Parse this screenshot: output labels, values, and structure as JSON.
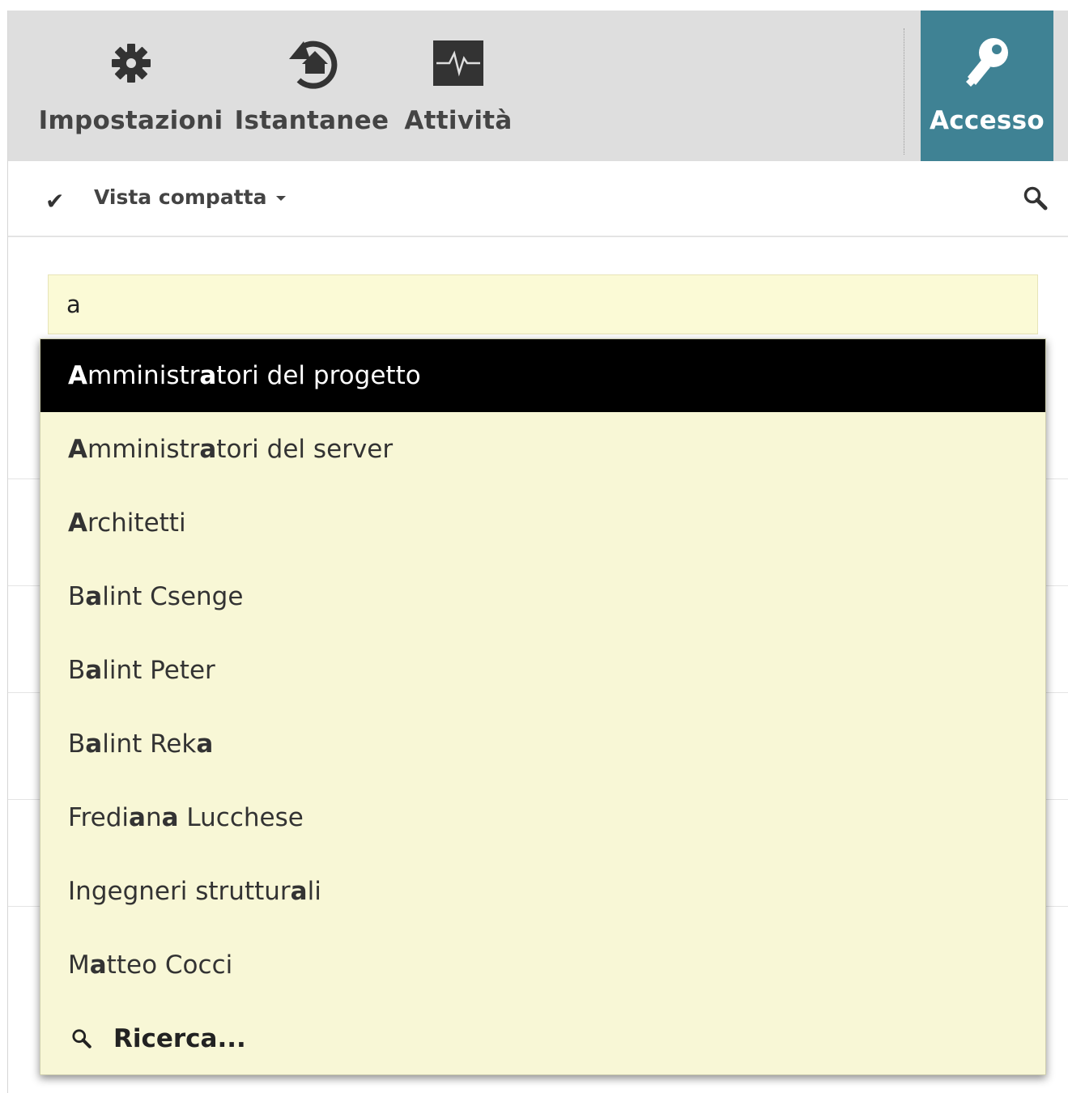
{
  "toolbar": {
    "impostazioni": {
      "label": "Impostazioni",
      "icon": "gear-icon"
    },
    "istantanee": {
      "label": "Istantanee",
      "icon": "history-home-icon"
    },
    "attivita": {
      "label": "Attività",
      "icon": "activity-monitor-icon"
    },
    "accesso": {
      "label": "Accesso",
      "icon": "key-icon",
      "active": true,
      "color": "#3f8294"
    }
  },
  "subbar": {
    "view_label": "Vista compatta",
    "checked": true,
    "search_icon": "search-icon"
  },
  "search": {
    "value": "a"
  },
  "dropdown": {
    "query": "a",
    "active_index": 0,
    "items": [
      {
        "label": "Amministratori del progetto"
      },
      {
        "label": "Amministratori del server"
      },
      {
        "label": "Architetti"
      },
      {
        "label": "Balint Csenge"
      },
      {
        "label": "Balint Peter"
      },
      {
        "label": "Balint Reka"
      },
      {
        "label": "Frediana Lucchese"
      },
      {
        "label": "Ingegneri strutturali"
      },
      {
        "label": "Matteo Cocci"
      }
    ],
    "search_more_label": "Ricerca...",
    "background": "#f8f7d6",
    "active_background": "#000000"
  }
}
